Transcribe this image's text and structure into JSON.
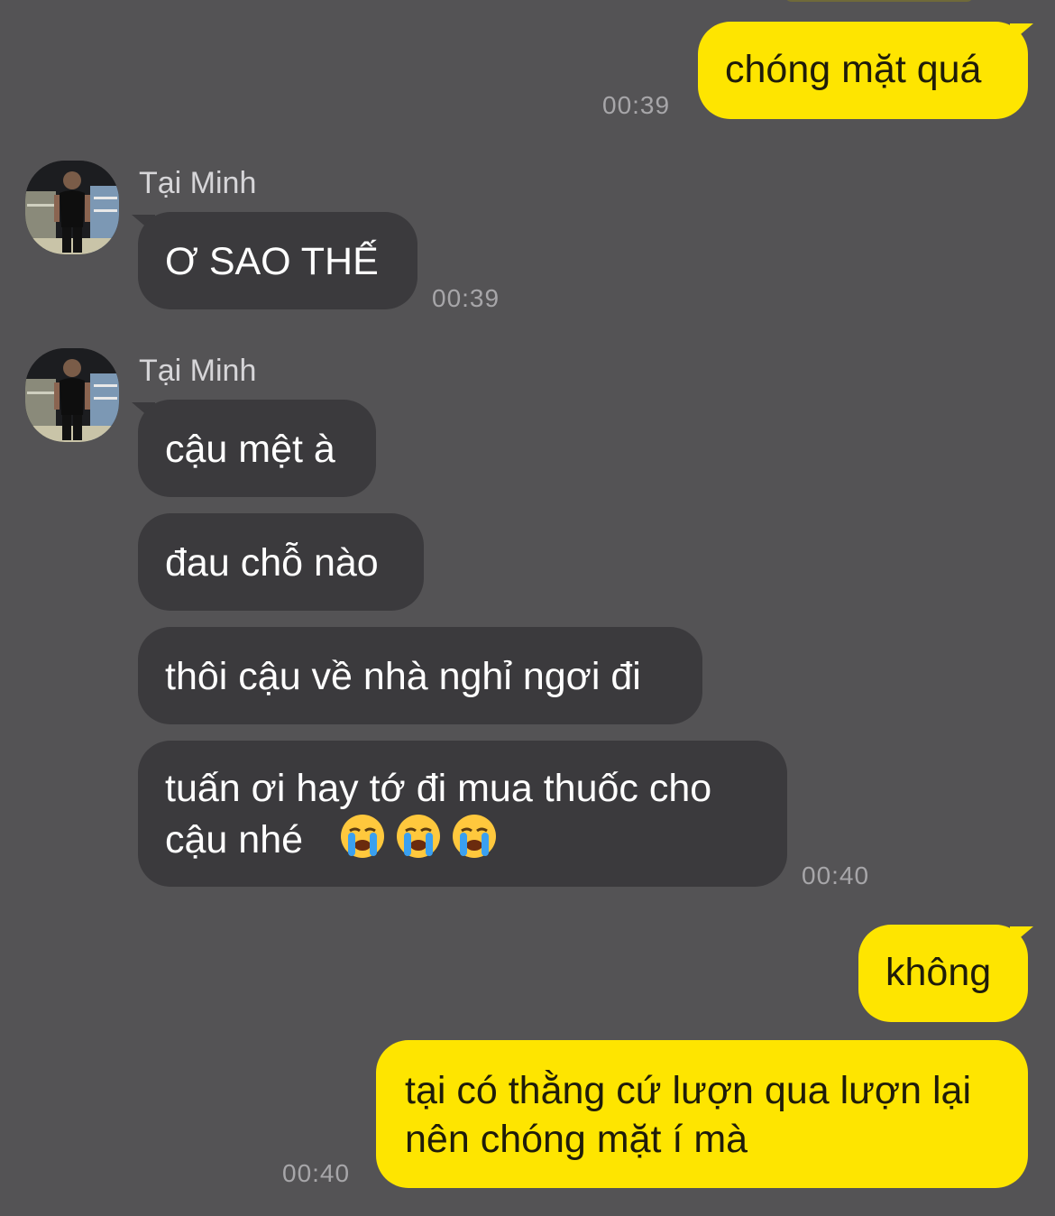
{
  "messages": [
    {
      "side": "me",
      "text": "chóng mặt quá",
      "time": "00:39"
    },
    {
      "side": "other",
      "sender": "Tại Minh",
      "text": "Ơ SAO THẾ",
      "time": "00:39"
    },
    {
      "side": "other",
      "sender": "Tại Minh",
      "text": "cậu mệt à"
    },
    {
      "side": "other",
      "text": "đau chỗ nào"
    },
    {
      "side": "other",
      "text": "thôi cậu về nhà nghỉ ngơi đi"
    },
    {
      "side": "other",
      "text_line1": "tuấn ơi hay tớ đi mua thuốc cho",
      "text_line2": "cậu nhé",
      "emojis": [
        "loudly-crying-face",
        "loudly-crying-face",
        "loudly-crying-face"
      ],
      "time": "00:40"
    },
    {
      "side": "me",
      "text": "không"
    },
    {
      "side": "me",
      "text_line1": "tại có thằng cứ lượn qua lượn lại",
      "text_line2": "nên chóng mặt í mà",
      "time": "00:40"
    }
  ],
  "colors": {
    "background": "#545355",
    "my_bubble": "#fee500",
    "their_bubble": "#3b3a3d",
    "timestamp": "#a7a6a9"
  }
}
